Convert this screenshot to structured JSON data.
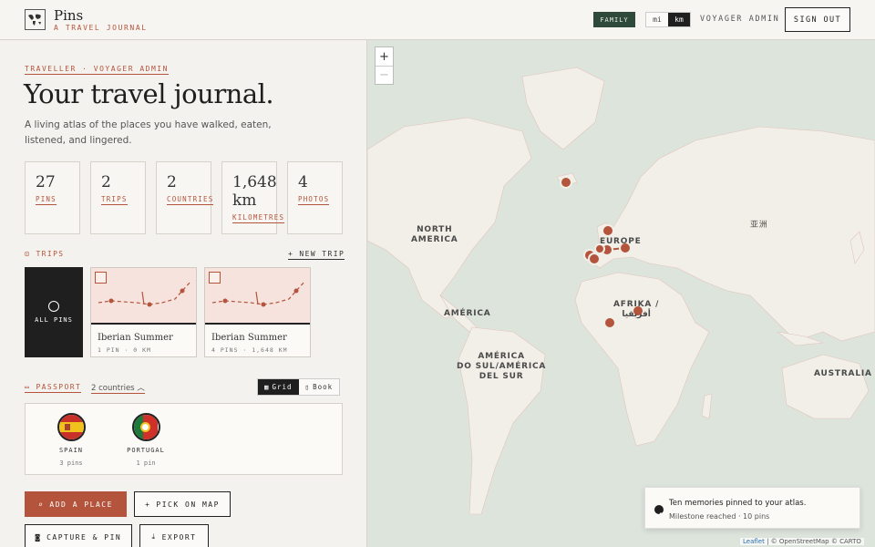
{
  "header": {
    "brand_name": "Pins",
    "brand_tagline": "A TRAVEL JOURNAL",
    "family_badge": "FAMILY",
    "units": [
      "mi",
      "km"
    ],
    "active_unit": "km",
    "user_label": "VOYAGER ADMIN",
    "signout_label": "SIGN OUT"
  },
  "intro": {
    "eyebrow": "TRAVELLER · VOYAGER ADMIN",
    "title": "Your travel journal.",
    "description": "A living atlas of the places you have walked, eaten, listened, and lingered."
  },
  "stats": [
    {
      "value": "27",
      "label": "PINS"
    },
    {
      "value": "2",
      "label": "TRIPS"
    },
    {
      "value": "2",
      "label": "COUNTRIES"
    },
    {
      "value": "1,648 km",
      "label": "KILOMETRES"
    },
    {
      "value": "4",
      "label": "PHOTOS"
    }
  ],
  "trips": {
    "label": "TRIPS",
    "new_trip": "+ NEW TRIP",
    "all_pins": "ALL PINS",
    "items": [
      {
        "name": "Iberian Summer",
        "meta": "1 PIN · 0 KM"
      },
      {
        "name": "Iberian Summer",
        "meta": "4 PINS · 1,648 KM"
      }
    ]
  },
  "passport": {
    "label": "PASSPORT",
    "country_select": "2 countries",
    "views": [
      "Grid",
      "Book"
    ],
    "active_view": "Grid",
    "countries": [
      {
        "name": "SPAIN",
        "pins": "3 pins"
      },
      {
        "name": "PORTUGAL",
        "pins": "1 pin"
      }
    ]
  },
  "actions": {
    "add_place": "ADD A PLACE",
    "pick_on_map": "PICK ON MAP",
    "capture_pin": "CAPTURE & PIN",
    "export": "EXPORT"
  },
  "map": {
    "zoom_in": "+",
    "zoom_out": "−",
    "labels": {
      "north_america": "NORTH\nAMERICA",
      "europe": "EUROPE",
      "asia": "亚洲",
      "america": "AMÉRICA",
      "south_america": "AMÉRICA\nDO SUL/AMÉRICA\nDEL SUR",
      "africa": "AFRIKA /\nأفريقيا",
      "australia": "AUSTRALIA"
    },
    "attribution_leaflet": "Leaflet",
    "attribution_rest": "| © OpenStreetMap © CARTO",
    "accent_color": "#b4543c"
  },
  "toast": {
    "title": "Ten memories pinned to your atlas.",
    "subtitle": "Milestone reached · 10 pins"
  },
  "colors": {
    "accent": "#b4543c",
    "dark": "#1f1f1f",
    "family_badge": "#2f4a3a",
    "map_water": "#dde4dc",
    "map_land": "#f1efe7"
  }
}
